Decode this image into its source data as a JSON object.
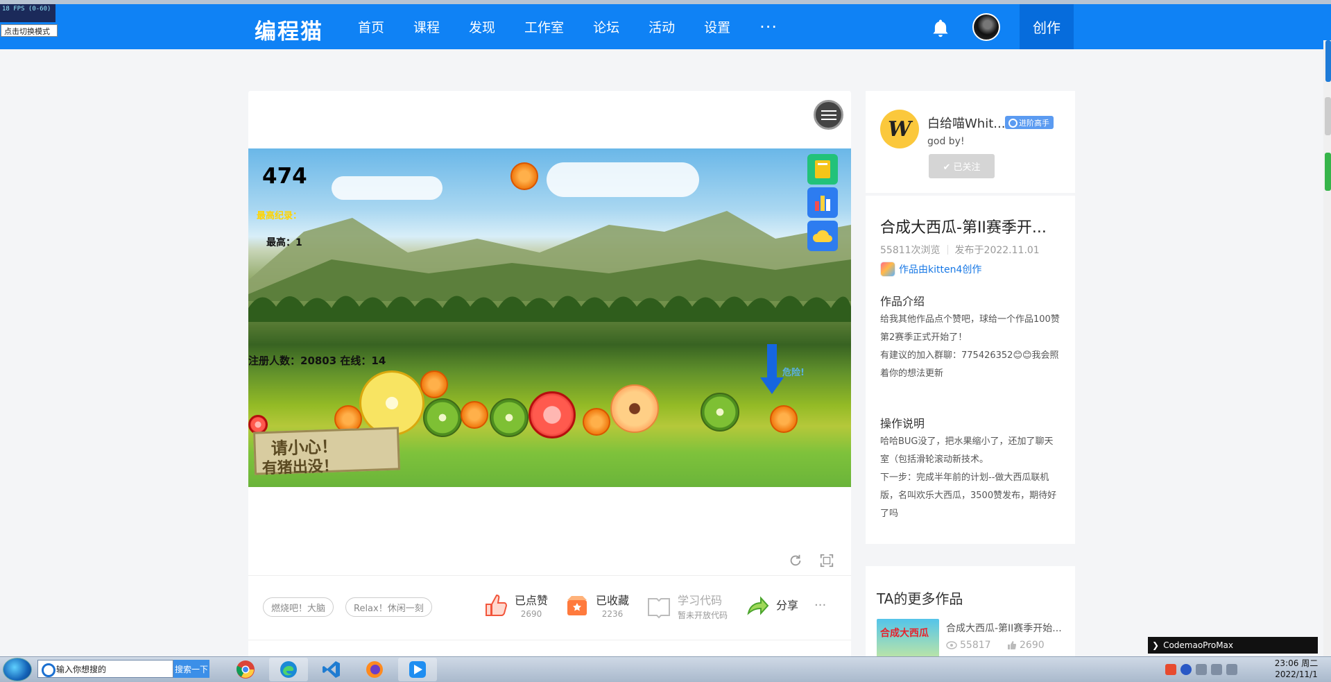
{
  "overlay": {
    "fps": "18 FPS (0-60)",
    "mode_tip": "点击切换模式"
  },
  "nav": {
    "logo": "编程猫",
    "items": [
      "首页",
      "课程",
      "发现",
      "工作室",
      "论坛",
      "活动",
      "设置"
    ],
    "more": "···",
    "create": "创作",
    "icons": {
      "bell": "bell-icon",
      "avatar": "user-avatar"
    }
  },
  "game": {
    "score": "474",
    "best_label": "最高纪录：",
    "best_value": "最高：1",
    "registered": "注册人数：20803 在线：14",
    "danger": "危险!",
    "sign_line1": "请小心！",
    "sign_line2": "有猪出没！"
  },
  "player_controls": {
    "refresh": "refresh-icon",
    "fullscreen": "fullscreen-icon"
  },
  "tags": [
    "燃烧吧！大脑",
    "Relax！休闲一刻"
  ],
  "actions": {
    "like": {
      "label": "已点赞",
      "count": "2690"
    },
    "collect": {
      "label": "已收藏",
      "count": "2236"
    },
    "code": {
      "label": "学习代码",
      "sub": "暂未开放代码"
    },
    "share": {
      "label": "分享"
    },
    "more": "···"
  },
  "author": {
    "avatar_letter": "W",
    "name": "白给喵Whit...",
    "badge": "进阶高手",
    "bio": "god by!",
    "follow": "✔ 已关注"
  },
  "work": {
    "title": "合成大西瓜-第II赛季开...",
    "views": "55811次浏览",
    "published": "发布于2022.11.01",
    "made_with": "作品由kitten4创作",
    "intro_title": "作品介绍",
    "intro": [
      "给我其他作品点个赞吧，球给一个作品100赞",
      "第2赛季正式开始了！",
      "有建议的加入群聊：775426352😊😊我会照着你的想法更新"
    ],
    "howto_title": "操作说明",
    "howto": [
      "哈哈BUG没了，把水果缩小了，还加了聊天室（包括滑轮滚动新技术。",
      "下一步：完成半年前的计划--做大西瓜联机版，名叫欢乐大西瓜，3500赞发布，期待好了吗"
    ]
  },
  "more_works": {
    "title": "TA的更多作品",
    "thumb_text": "合成大西瓜",
    "item_name": "合成大西瓜-第II赛季开始...",
    "views": "55817",
    "likes": "2690"
  },
  "codemao_tab": "CodemaoProMax",
  "taskbar": {
    "search_placeholder": "输入你想搜的",
    "search_button": "搜索一下",
    "time": "23:06 周二",
    "date": "2022/11/1"
  },
  "colors": {
    "brand": "#0f82f5",
    "link": "#1677e5",
    "badge": "#5b9bf1"
  }
}
